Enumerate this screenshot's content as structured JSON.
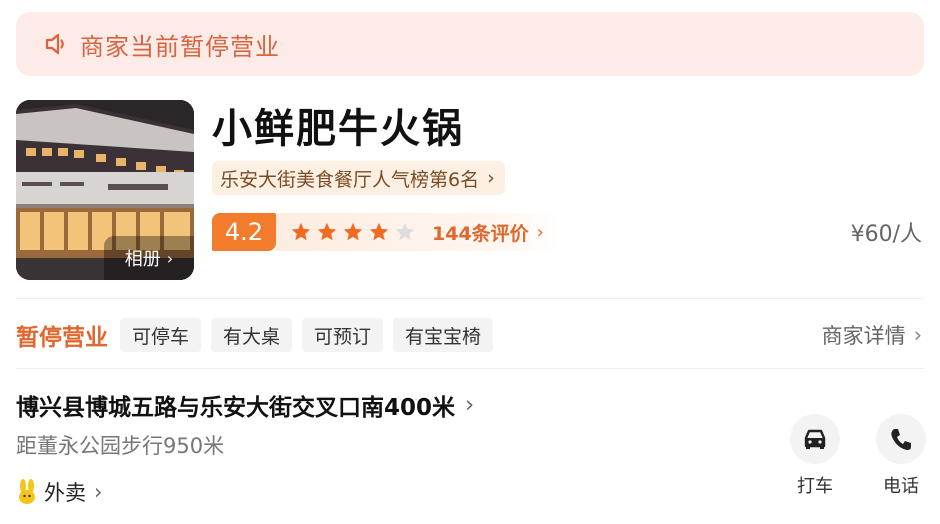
{
  "notice": {
    "icon": "speaker-icon",
    "text": "商家当前暂停营业"
  },
  "store": {
    "name": "小鲜肥牛火锅",
    "photo_album_label": "相册",
    "rank_text": "乐安大街美食餐厅人气榜第6名",
    "rating_score": "4.2",
    "stars_filled": 4,
    "stars_total": 5,
    "review_count_text": "144条评价",
    "price_text": "¥60/人"
  },
  "status": {
    "label": "暂停营业",
    "tags": [
      "可停车",
      "有大桌",
      "可预订",
      "有宝宝椅"
    ],
    "detail_link": "商家详情"
  },
  "location": {
    "address": "博兴县博城五路与乐安大街交叉口南400米",
    "distance": "距董永公园步行950米",
    "takeout_label": "外卖"
  },
  "actions": {
    "taxi_label": "打车",
    "phone_label": "电话"
  },
  "colors": {
    "accent": "#f27b2c",
    "status_orange": "#e0672d",
    "notice_bg": "#fcebe6",
    "notice_text": "#d9623f",
    "star_filled": "#f06a24",
    "star_empty": "#dddddd"
  }
}
